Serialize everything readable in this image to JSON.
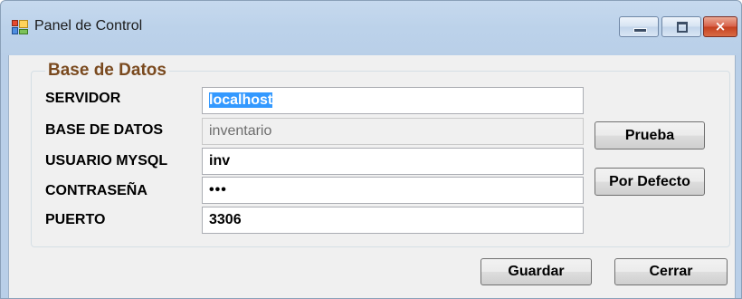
{
  "window": {
    "title": "Panel de Control",
    "controls": {
      "minimize": "minimize",
      "maximize": "maximize",
      "close": "×"
    }
  },
  "group": {
    "title": "Base de Datos",
    "fields": [
      {
        "label": "SERVIDOR",
        "value": "localhost",
        "selected": true,
        "enabled": true
      },
      {
        "label": "BASE DE DATOS",
        "value": "inventario",
        "enabled": false
      },
      {
        "label": "USUARIO MYSQL",
        "value": "inv",
        "enabled": true
      },
      {
        "label": "CONTRASEÑA",
        "value": "•••",
        "enabled": true
      },
      {
        "label": "PUERTO",
        "value": "3306",
        "enabled": true
      }
    ],
    "buttons": {
      "test": "Prueba",
      "default": "Por Defecto"
    }
  },
  "footer": {
    "save": "Guardar",
    "close": "Cerrar"
  },
  "colors": {
    "group_title": "#7a4a1f",
    "selection": "#3399ff",
    "close_button": "#c4401f"
  }
}
